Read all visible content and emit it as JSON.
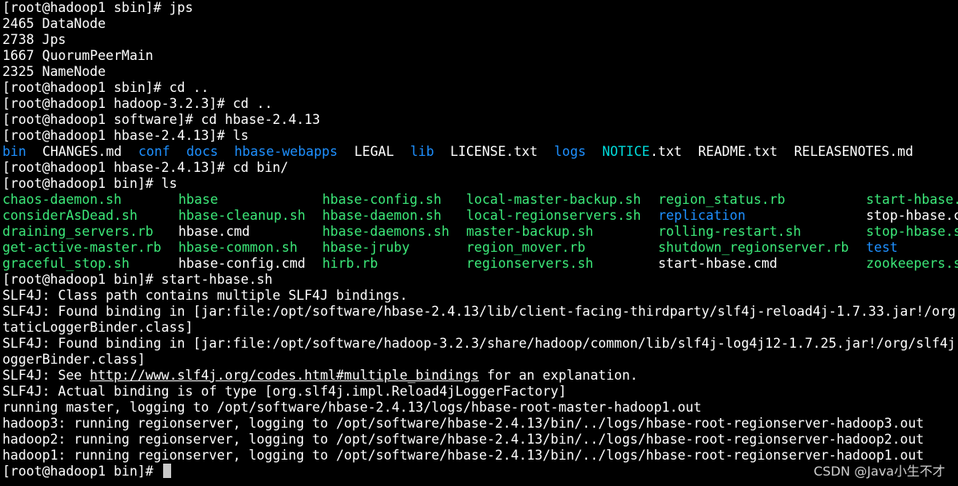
{
  "terminal": {
    "line0": "[root@hadoop1 sbin]# jps",
    "line1": "2465 DataNode",
    "line2": "2738 Jps",
    "line3": "1667 QuorumPeerMain",
    "line4": "2325 NameNode",
    "line5": "[root@hadoop1 sbin]# cd ..",
    "line6": "[root@hadoop1 hadoop-3.2.3]# cd ..",
    "line7": "[root@hadoop1 software]# cd hbase-2.4.13",
    "line8": "[root@hadoop1 hbase-2.4.13]# ls",
    "ls1": {
      "bin": "bin",
      "changes": "CHANGES.md",
      "conf": "conf",
      "docs": "docs",
      "webapps": "hbase-webapps",
      "legal": "LEGAL",
      "lib": "lib",
      "license": "LICENSE.txt",
      "logs": "logs",
      "notice_a": "NOTICE",
      "notice_b": ".txt",
      "readme": "README.txt",
      "releasenotes": "RELEASENOTES.md"
    },
    "line10": "[root@hadoop1 hbase-2.4.13]# cd bin/",
    "line11": "[root@hadoop1 bin]# ls",
    "ls2": {
      "r0c0": "chaos-daemon.sh",
      "r0c1": "hbase",
      "r0c2": "hbase-config.sh",
      "r0c3": "local-master-backup.sh",
      "r0c4": "region_status.rb",
      "r0c5": "start-hbase.",
      "r1c0": "considerAsDead.sh",
      "r1c1": "hbase-cleanup.sh",
      "r1c2": "hbase-daemon.sh",
      "r1c3": "local-regionservers.sh",
      "r1c4": "replication",
      "r1c5": "stop-hbase.c",
      "r2c0": "draining_servers.rb",
      "r2c1": "hbase.cmd",
      "r2c2": "hbase-daemons.sh",
      "r2c3": "master-backup.sh",
      "r2c4": "rolling-restart.sh",
      "r2c5": "stop-hbase.s",
      "r3c0": "get-active-master.rb",
      "r3c1": "hbase-common.sh",
      "r3c2": "hbase-jruby",
      "r3c3": "region_mover.rb",
      "r3c4": "shutdown_regionserver.rb",
      "r3c5": "test",
      "r4c0": "graceful_stop.sh",
      "r4c1": "hbase-config.cmd",
      "r4c2": "hirb.rb",
      "r4c3": "regionservers.sh",
      "r4c4": "start-hbase.cmd",
      "r4c5": "zookeepers.s"
    },
    "line17": "[root@hadoop1 bin]# start-hbase.sh",
    "line18": "SLF4J: Class path contains multiple SLF4J bindings.",
    "line19": "SLF4J: Found binding in [jar:file:/opt/software/hbase-2.4.13/lib/client-facing-thirdparty/slf4j-reload4j-1.7.33.jar!/org",
    "line20": "taticLoggerBinder.class]",
    "line21": "SLF4J: Found binding in [jar:file:/opt/software/hadoop-3.2.3/share/hadoop/common/lib/slf4j-log4j12-1.7.25.jar!/org/slf4j",
    "line22": "oggerBinder.class]",
    "line23_a": "SLF4J: See ",
    "line23_link": "http://www.slf4j.org/codes.html#multiple_bindings",
    "line23_b": " for an explanation.",
    "line24": "SLF4J: Actual binding is of type [org.slf4j.impl.Reload4jLoggerFactory]",
    "line25": "running master, logging to /opt/software/hbase-2.4.13/logs/hbase-root-master-hadoop1.out",
    "line26": "hadoop3: running regionserver, logging to /opt/software/hbase-2.4.13/bin/../logs/hbase-root-regionserver-hadoop3.out",
    "line27": "hadoop2: running regionserver, logging to /opt/software/hbase-2.4.13/bin/../logs/hbase-root-regionserver-hadoop2.out",
    "line28": "hadoop1: running regionserver, logging to /opt/software/hbase-2.4.13/bin/../logs/hbase-root-regionserver-hadoop1.out",
    "line29": "[root@hadoop1 bin]# "
  },
  "watermark": "CSDN @Java小生不才",
  "colors": {
    "background": "#000000",
    "text": "#ffffff",
    "directory": "#1e90ff",
    "symlink": "#00d7d7",
    "executable": "#3ce879"
  }
}
